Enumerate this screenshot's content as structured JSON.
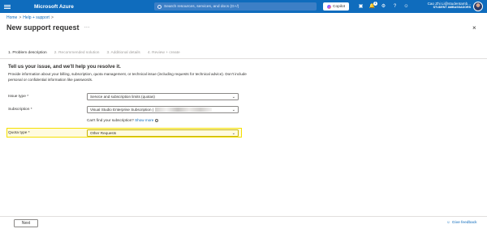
{
  "topbar": {
    "brand": "Microsoft Azure",
    "search_placeholder": "Search resources, services, and docs (G+/)",
    "copilot_label": "Copilot",
    "notification_count": "1",
    "user_name": "Cao Zhi Li@studentamb...",
    "user_tenant": "STUDENT AMBASSADORS"
  },
  "breadcrumb": {
    "home": "Home",
    "sep": ">",
    "help": "Help + support",
    "sep2": ">"
  },
  "page": {
    "title": "New support request",
    "more": "...",
    "close": "×"
  },
  "tabs": [
    {
      "label": "1. Problem description"
    },
    {
      "label": "2. Recommended solution"
    },
    {
      "label": "3. Additional details"
    },
    {
      "label": "4. Review + create"
    }
  ],
  "form": {
    "section_title": "Tell us your issue, and we'll help you resolve it.",
    "description": "Provide information about your billing, subscription, quota management, or technical issue (including requests for technical advice). Don't include personal or confidential information like passwords.",
    "issue_type_label": "Issue type *",
    "issue_type_value": "Service and subscription limits (quotas)",
    "subscription_label": "Subscription *",
    "subscription_value": "Visual Studio Enterprise Subscription (",
    "hint_text": "Can't find your subscription?",
    "hint_link": "Show more",
    "quota_type_label": "Quota type *",
    "quota_type_value": "Other Requests"
  },
  "footer": {
    "next_label": "Next",
    "feedback_label": "Give feedback"
  },
  "colors": {
    "brand_blue": "#0f6cbd",
    "highlight": "#f5e000"
  }
}
